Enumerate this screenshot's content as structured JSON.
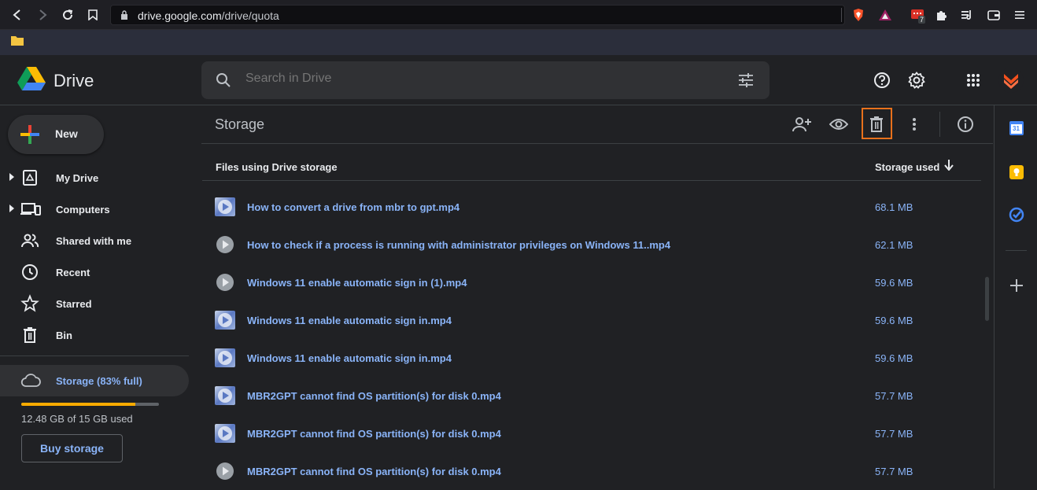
{
  "browser": {
    "url_host": "drive.google.com",
    "url_path": "/drive/quota",
    "extension_badge": "7"
  },
  "header": {
    "logo_text": "Drive",
    "search_placeholder": "Search in Drive"
  },
  "sidebar": {
    "new_label": "New",
    "items": [
      {
        "label": "My Drive",
        "icon": "my-drive-icon",
        "expandable": true
      },
      {
        "label": "Computers",
        "icon": "computers-icon",
        "expandable": true
      },
      {
        "label": "Shared with me",
        "icon": "shared-icon",
        "expandable": false
      },
      {
        "label": "Recent",
        "icon": "clock-icon",
        "expandable": false
      },
      {
        "label": "Starred",
        "icon": "star-icon",
        "expandable": false
      },
      {
        "label": "Bin",
        "icon": "trash-icon",
        "expandable": false
      }
    ],
    "storage_label": "Storage (83% full)",
    "storage_fraction": 0.83,
    "storage_text": "12.48 GB of 15 GB used",
    "buy_storage_label": "Buy storage"
  },
  "main": {
    "title": "Storage",
    "col_files": "Files using Drive storage",
    "col_storage": "Storage used",
    "files": [
      {
        "name": "How to convert a drive from mbr to gpt.mp4",
        "size": "68.1 MB",
        "thumb": "video"
      },
      {
        "name": "How to check if a process is running with administrator privileges on Windows 11..mp4",
        "size": "62.1 MB",
        "thumb": "play"
      },
      {
        "name": "Windows 11 enable automatic sign in (1).mp4",
        "size": "59.6 MB",
        "thumb": "play"
      },
      {
        "name": "Windows 11 enable automatic sign in.mp4",
        "size": "59.6 MB",
        "thumb": "video"
      },
      {
        "name": "Windows 11 enable automatic sign in.mp4",
        "size": "59.6 MB",
        "thumb": "video"
      },
      {
        "name": "MBR2GPT cannot find OS partition(s) for disk 0.mp4",
        "size": "57.7 MB",
        "thumb": "video"
      },
      {
        "name": "MBR2GPT cannot find OS partition(s) for disk 0.mp4",
        "size": "57.7 MB",
        "thumb": "video"
      },
      {
        "name": "MBR2GPT cannot find OS partition(s) for disk 0.mp4",
        "size": "57.7 MB",
        "thumb": "play"
      }
    ]
  },
  "side_panel": {
    "calendar_day": "31"
  },
  "colors": {
    "accent_blue": "#8ab4f8",
    "storage_fill": "#f9ab00",
    "highlight": "#e8711c"
  }
}
